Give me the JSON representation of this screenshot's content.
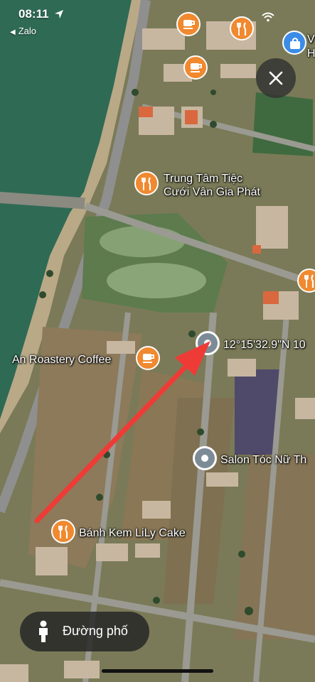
{
  "status_bar": {
    "time": "08:11",
    "back_app": "Zalo"
  },
  "map": {
    "places": [
      {
        "name": "Trung Tâm Tiệc",
        "name_line2": "Cưới Vân Gia Phát",
        "type": "restaurant"
      },
      {
        "name": "An Roastery Coffee",
        "type": "cafe"
      },
      {
        "name": "Salon Tóc Nữ Th",
        "type": "place"
      },
      {
        "name": "Bánh Kem LiLy Cake",
        "type": "restaurant"
      }
    ],
    "coordinate": "12°15'32.9\"N 10",
    "edge_label": "V\nH"
  },
  "street_view_button": {
    "label": "Đường phố"
  },
  "colors": {
    "pin_orange": "#f0892f",
    "pin_gray": "#7d8b97",
    "arrow_red": "#ef3b36",
    "water": "#2f6a55"
  }
}
